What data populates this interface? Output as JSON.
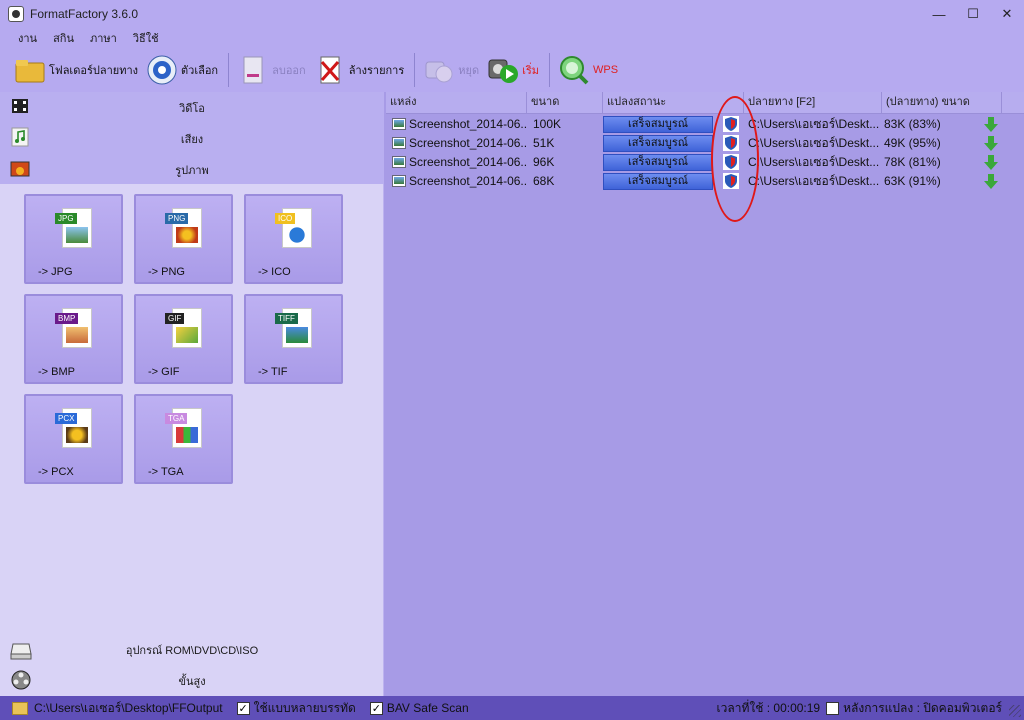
{
  "window": {
    "title": "FormatFactory 3.6.0",
    "min": "—",
    "max": "☐",
    "close": "✕"
  },
  "menu": [
    "งาน",
    "สกิน",
    "ภาษา",
    "วิธีใช้"
  ],
  "toolbar": {
    "output_folder": "โฟลเดอร์ปลายทาง",
    "options": "ตัวเลือก",
    "remove": "ลบออก",
    "clear_list": "ล้างรายการ",
    "stop": "หยุด",
    "start": "เริ่ม",
    "wps": "WPS"
  },
  "left": {
    "categories": [
      "วิดีโอ",
      "เสียง",
      "รูปภาพ"
    ],
    "tiles": [
      "-> JPG",
      "-> PNG",
      "-> ICO",
      "-> BMP",
      "-> GIF",
      "-> TIF",
      "-> PCX",
      "-> TGA"
    ],
    "tile_tags": [
      "JPG",
      "PNG",
      "ICO",
      "BMP",
      "GIF",
      "TIFF",
      "PCX",
      "TGA"
    ],
    "bottom_categories": [
      "อุปกรณ์ ROM\\DVD\\CD\\ISO",
      "ขั้นสูง"
    ]
  },
  "list": {
    "headers": [
      "แหล่ง",
      "ขนาด",
      "แปลงสถานะ",
      "ปลายทาง [F2]",
      "(ปลายทาง) ขนาด"
    ],
    "rows": [
      {
        "source": "Screenshot_2014-06...",
        "size": "100K",
        "status": "เสร็จสมบูรณ์",
        "output": "C:\\Users\\เอเซอร์\\Deskt...",
        "out_size": "83K  (83%)"
      },
      {
        "source": "Screenshot_2014-06...",
        "size": "51K",
        "status": "เสร็จสมบูรณ์",
        "output": "C:\\Users\\เอเซอร์\\Deskt...",
        "out_size": "49K  (95%)"
      },
      {
        "source": "Screenshot_2014-06...",
        "size": "96K",
        "status": "เสร็จสมบูรณ์",
        "output": "C:\\Users\\เอเซอร์\\Deskt...",
        "out_size": "78K  (81%)"
      },
      {
        "source": "Screenshot_2014-06...",
        "size": "68K",
        "status": "เสร็จสมบูรณ์",
        "output": "C:\\Users\\เอเซอร์\\Deskt...",
        "out_size": "63K  (91%)"
      }
    ]
  },
  "status": {
    "path": "C:\\Users\\เอเซอร์\\Desktop\\FFOutput",
    "multithread": "ใช้แบบหลายบรรทัด",
    "bav": "BAV Safe Scan",
    "elapsed": "เวลาที่ใช้ : 00:00:19",
    "after_convert": "หลังการแปลง : ปิดคอมพิวเตอร์"
  },
  "colors": {
    "accent": "#a79be6",
    "progress": "#4f6fe0",
    "highlight_circle": "#e01818",
    "arrow": "#3aa83a"
  }
}
